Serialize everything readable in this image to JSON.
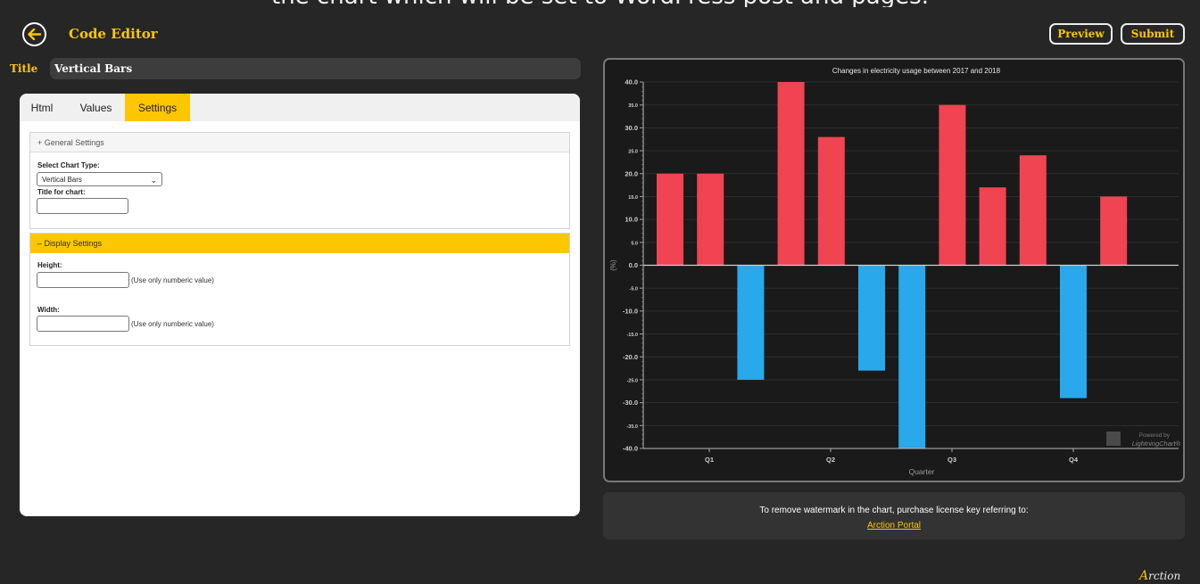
{
  "top_caption": "the chart which will be set to WordPress post and pages.",
  "header": {
    "title": "Code Editor",
    "preview_label": "Preview",
    "submit_label": "Submit"
  },
  "title_field": {
    "label": "Title",
    "value": "Vertical Bars"
  },
  "tabs": [
    {
      "label": "Html",
      "active": false
    },
    {
      "label": "Values",
      "active": false
    },
    {
      "label": "Settings",
      "active": true
    }
  ],
  "general_settings": {
    "heading": "+ General Settings",
    "chart_type_label": "Select Chart Type:",
    "chart_type_value": "Vertical Bars",
    "chart_title_label": "Title for chart:",
    "chart_title_value": ""
  },
  "display_settings": {
    "heading": "– Display Settings",
    "height_label": "Height:",
    "height_value": "",
    "height_hint": "(Use only numberic value)",
    "width_label": "Width:",
    "width_value": "",
    "width_hint": "(Use only numberic value)"
  },
  "chart_data": {
    "type": "bar",
    "title": "Changes in electricity usage between 2017 and 2018",
    "xlabel": "Quarter",
    "ylabel": "(%)",
    "ylim": [
      -40,
      40
    ],
    "yticks": [
      "40.0",
      "35.0",
      "30.0",
      "25.0",
      "20.0",
      "15.0",
      "10.0",
      "5.0",
      "0.0",
      "-5.0",
      "-10.0",
      "-15.0",
      "-20.0",
      "-25.0",
      "-30.0",
      "-35.0",
      "-40.0"
    ],
    "categories": [
      "Q1",
      "Q2",
      "Q3",
      "Q4"
    ],
    "values": [
      20,
      20,
      -25,
      40,
      28,
      -23,
      -40,
      35,
      17,
      24,
      -29,
      15
    ],
    "positive_color": "#f04452",
    "negative_color": "#29a8ec",
    "grid": true,
    "watermark_line1": "Powered by",
    "watermark_line2": "LightningChart®"
  },
  "notice": {
    "text": "To remove watermark in the chart, purchase license key referring to:",
    "link": "Arction Portal"
  },
  "brand": {
    "initial": "A",
    "rest": "rction"
  },
  "colors": {
    "accent": "#fcc600",
    "background": "#262626"
  }
}
